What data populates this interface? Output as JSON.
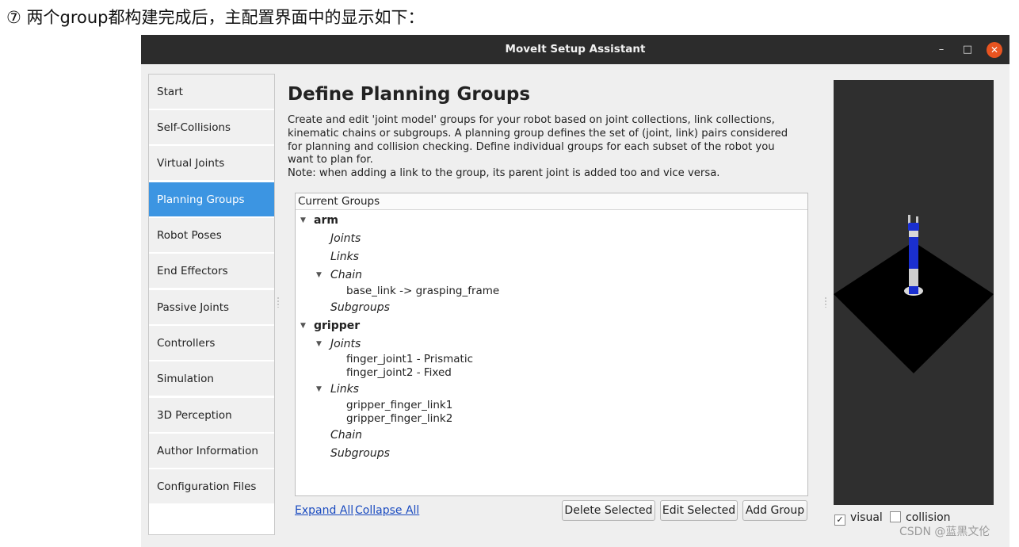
{
  "caption": "⑦ 两个group都构建完成后，主配置界面中的显示如下：",
  "window": {
    "title": "MoveIt Setup Assistant",
    "controls": {
      "minimize": "–",
      "maximize": "□",
      "close": "✕"
    }
  },
  "sidebar": {
    "items": [
      {
        "label": "Start"
      },
      {
        "label": "Self-Collisions"
      },
      {
        "label": "Virtual Joints"
      },
      {
        "label": "Planning Groups",
        "active": true
      },
      {
        "label": "Robot Poses"
      },
      {
        "label": "End Effectors"
      },
      {
        "label": "Passive Joints"
      },
      {
        "label": "Controllers"
      },
      {
        "label": "Simulation"
      },
      {
        "label": "3D Perception"
      },
      {
        "label": "Author Information"
      },
      {
        "label": "Configuration Files"
      }
    ]
  },
  "main": {
    "title": "Define Planning Groups",
    "description": "Create and edit 'joint model' groups for your robot based on joint collections, link collections,\nkinematic chains or subgroups. A planning group defines the set of (joint, link) pairs considered\nfor planning and collision checking. Define individual groups for each subset of the robot you\nwant to plan for.\nNote: when adding a link to the group, its parent joint is added too and vice versa.",
    "tree_header": "Current Groups",
    "tree": [
      {
        "text": "arm",
        "kind": "group",
        "expanded": true
      },
      {
        "text": "Joints",
        "kind": "cat"
      },
      {
        "text": "Links",
        "kind": "cat"
      },
      {
        "text": "Chain",
        "kind": "cat",
        "expanded": true
      },
      {
        "text": "base_link  ->  grasping_frame",
        "kind": "leaf"
      },
      {
        "text": "Subgroups",
        "kind": "cat"
      },
      {
        "text": "gripper",
        "kind": "group",
        "expanded": true
      },
      {
        "text": "Joints",
        "kind": "cat",
        "expanded": true
      },
      {
        "text": "finger_joint1 - Prismatic",
        "kind": "leaf"
      },
      {
        "text": "finger_joint2 - Fixed",
        "kind": "leaf"
      },
      {
        "text": "Links",
        "kind": "cat",
        "expanded": true
      },
      {
        "text": "gripper_finger_link1",
        "kind": "leaf"
      },
      {
        "text": "gripper_finger_link2",
        "kind": "leaf"
      },
      {
        "text": "Chain",
        "kind": "cat"
      },
      {
        "text": "Subgroups",
        "kind": "cat"
      }
    ],
    "expand_all": "Expand All",
    "collapse_all": "Collapse All",
    "buttons": {
      "delete": "Delete Selected",
      "edit": "Edit Selected",
      "add": "Add Group"
    }
  },
  "viewer": {
    "visual_label": "visual",
    "visual_checked": true,
    "collision_label": "collision",
    "collision_checked": false,
    "background_color": "#2f2f2f",
    "robot_accent_color": "#1a2fd0"
  },
  "colors": {
    "titlebar": "#2c2c2c",
    "active_nav": "#3c95e2",
    "close_button": "#e95420",
    "link": "#1a4bc0"
  },
  "watermark": "CSDN @蓝黑文伦"
}
